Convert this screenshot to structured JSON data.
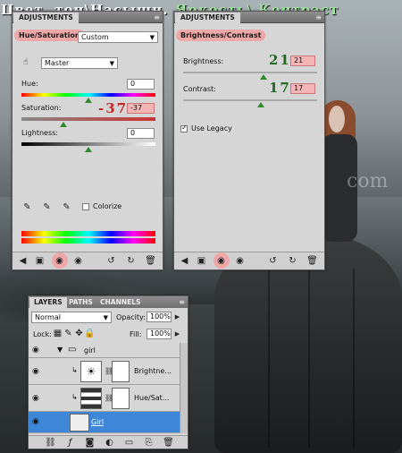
{
  "background": {
    "title_left": "Цвет. тон\\Насыщн.",
    "title_right": "Яркость\\ Контраст",
    "watermark": "com"
  },
  "hue_panel": {
    "tab": "ADJUSTMENTS",
    "menu_icon": "≡",
    "heading": "Hue/Saturation",
    "preset": "Custom",
    "channel": "Master",
    "hue_label": "Hue:",
    "hue_value": "0",
    "saturation_label": "Saturation:",
    "saturation_value": "-37",
    "saturation_big": "-37",
    "lightness_label": "Lightness:",
    "lightness_value": "0",
    "colorize_label": "Colorize",
    "hue_level": 0.5,
    "saturation_level": 0.31,
    "lightness_level": 0.5
  },
  "bc_panel": {
    "tab": "ADJUSTMENTS",
    "menu_icon": "≡",
    "heading": "Brightness/Contrast",
    "brightness_label": "Brightness:",
    "brightness_value": "21",
    "brightness_big": "21",
    "contrast_label": "Contrast:",
    "contrast_value": "17",
    "contrast_big": "17",
    "legacy_label": "Use Legacy",
    "brightness_level": 0.6,
    "contrast_level": 0.58
  },
  "layers_panel": {
    "tabs": [
      "LAYERS",
      "PATHS",
      "CHANNELS"
    ],
    "blend_mode": "Normal",
    "opacity_label": "Opacity:",
    "opacity_value": "100%",
    "lock_label": "Lock:",
    "fill_label": "Fill:",
    "fill_value": "100%",
    "group_name": "girl",
    "layers": [
      "Brightne...",
      "Hue/Sat...",
      "Girl"
    ]
  },
  "colors": {
    "panel_bg": "#d6d6d6",
    "highlight": "#f0a7a7",
    "selected_layer": "#3d86d8",
    "slider_thumb": "#2f8a2f"
  }
}
